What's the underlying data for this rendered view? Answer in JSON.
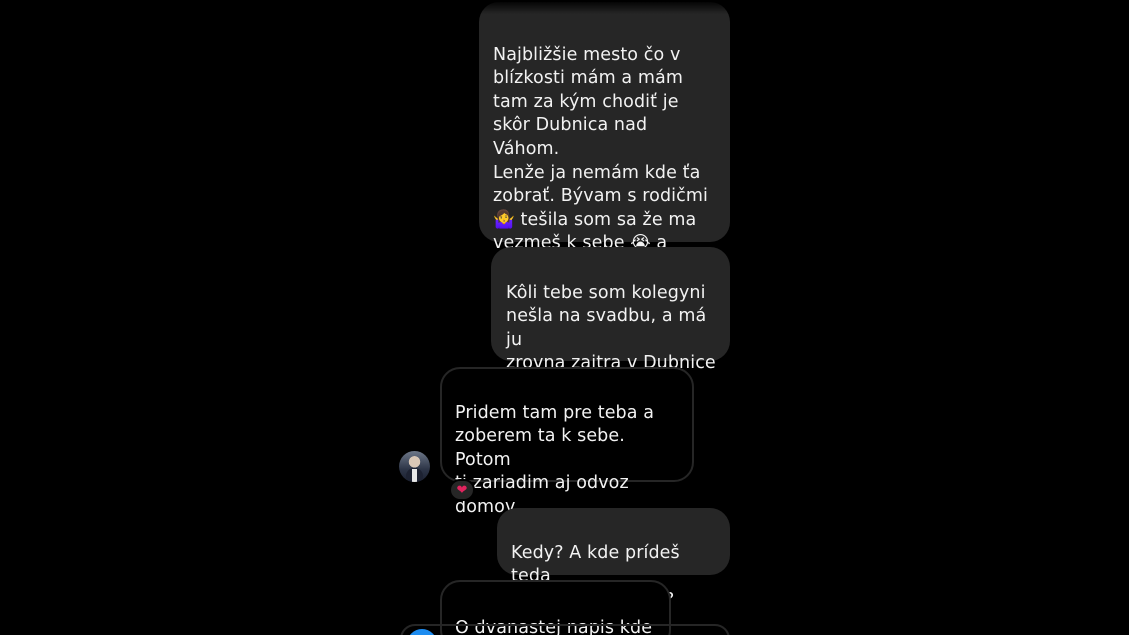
{
  "messages": [
    {
      "direction": "outgoing",
      "text": "Najbližšie mesto čo v\nblízkosti mám a mám\ntam za kým chodiť je\nskôr Dubnica nad Váhom.\nLenže ja nemám kde ťa\nzobrať. Bývam s rodičmi\n🤷‍♀️ tešila som sa že ma\nvezmeš k sebe 😭 a\nvysexuješ zo mňa dušu 😬"
    },
    {
      "direction": "outgoing",
      "text": "Kôli tebe som kolegyni\nnešla na svadbu, a má ju\nzrovna zajtra v Dubnice\nnad Váhom 🙄"
    },
    {
      "direction": "incoming",
      "text": "Pridem tam pre teba a\nzoberem ta k sebe. Potom\nti zariadim aj odvoz\ndomov",
      "reaction": "❤"
    },
    {
      "direction": "outgoing",
      "text": "Kedy? A kde prídeš teda\npo mňa? O koľkej?"
    },
    {
      "direction": "incoming",
      "text": "O dvanastej napis kde v"
    }
  ],
  "colors": {
    "background": "#000000",
    "outgoing_bubble": "#262626",
    "incoming_border": "#262626",
    "text": "#f2f2f2",
    "reaction": "#e0245e"
  },
  "icons": {
    "avatar": "contact-avatar",
    "reaction": "heart-icon"
  }
}
